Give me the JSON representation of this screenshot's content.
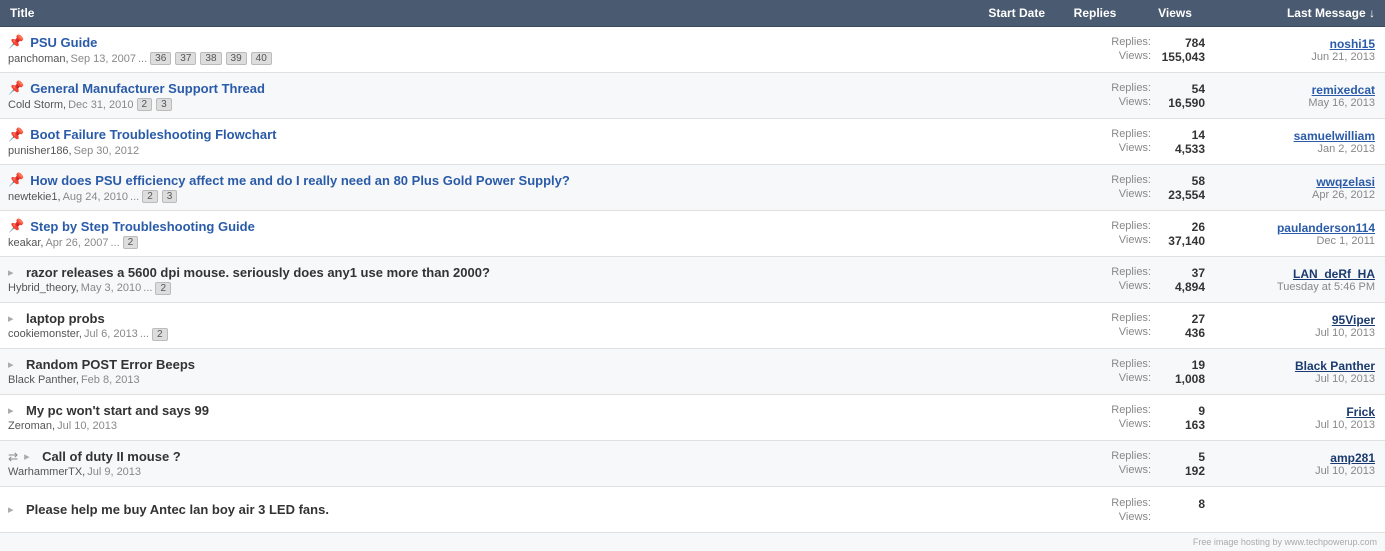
{
  "header": {
    "col_title": "Title",
    "col_start_date": "Start Date",
    "col_replies": "Replies",
    "col_views": "Views",
    "col_last_message": "Last Message ↓"
  },
  "rows": [
    {
      "id": "psu-guide",
      "pinned": true,
      "locked": false,
      "arrow": false,
      "multiicon": false,
      "title": "PSU Guide",
      "title_style": "link",
      "author": "panchoman",
      "date": "Sep 13, 2007",
      "has_ellipsis": true,
      "pages": [
        "36",
        "37",
        "38",
        "39",
        "40"
      ],
      "replies": "784",
      "views": "155,043",
      "last_user": "noshi15",
      "last_user_style": "normal",
      "last_date": "Jun 21, 2013"
    },
    {
      "id": "general-manufacturer",
      "pinned": true,
      "locked": false,
      "arrow": false,
      "multiicon": false,
      "title": "General Manufacturer Support Thread",
      "title_style": "link",
      "author": "Cold Storm",
      "date": "Dec 31, 2010",
      "has_ellipsis": false,
      "pages": [
        "2",
        "3"
      ],
      "replies": "54",
      "views": "16,590",
      "last_user": "remixedcat",
      "last_user_style": "normal",
      "last_date": "May 16, 2013"
    },
    {
      "id": "boot-failure",
      "pinned": true,
      "locked": false,
      "arrow": false,
      "multiicon": false,
      "title": "Boot Failure Troubleshooting Flowchart",
      "title_style": "link",
      "author": "punisher186",
      "date": "Sep 30, 2012",
      "has_ellipsis": false,
      "pages": [],
      "replies": "14",
      "views": "4,533",
      "last_user": "samuelwilliam",
      "last_user_style": "normal",
      "last_date": "Jan 2, 2013"
    },
    {
      "id": "psu-efficiency",
      "pinned": true,
      "locked": false,
      "arrow": false,
      "multiicon": false,
      "title": "How does PSU efficiency affect me and do I really need an 80 Plus Gold Power Supply?",
      "title_style": "link",
      "author": "newtekie1",
      "date": "Aug 24, 2010",
      "has_ellipsis": true,
      "pages": [
        "2",
        "3"
      ],
      "replies": "58",
      "views": "23,554",
      "last_user": "wwqzelasi",
      "last_user_style": "normal",
      "last_date": "Apr 26, 2012"
    },
    {
      "id": "step-by-step",
      "pinned": true,
      "locked": false,
      "arrow": false,
      "multiicon": false,
      "title": "Step by Step Troubleshooting Guide",
      "title_style": "link",
      "author": "keakar",
      "date": "Apr 26, 2007",
      "has_ellipsis": true,
      "pages": [
        "2"
      ],
      "replies": "26",
      "views": "37,140",
      "last_user": "paulanderson114",
      "last_user_style": "normal",
      "last_date": "Dec 1, 2011"
    },
    {
      "id": "razor-mouse",
      "pinned": false,
      "locked": false,
      "arrow": true,
      "multiicon": false,
      "title": "razor releases a 5600 dpi mouse. seriously does any1 use more than 2000?",
      "title_style": "dark-link",
      "author": "Hybrid_theory",
      "date": "May 3, 2010",
      "has_ellipsis": true,
      "pages": [
        "2"
      ],
      "replies": "37",
      "views": "4,894",
      "last_user": "LAN_deRf_HA",
      "last_user_style": "bold",
      "last_date": "Tuesday at 5:46 PM"
    },
    {
      "id": "laptop-probs",
      "pinned": false,
      "locked": false,
      "arrow": true,
      "multiicon": false,
      "title": "laptop probs",
      "title_style": "dark-link",
      "author": "cookiemonster",
      "date": "Jul 6, 2013",
      "has_ellipsis": true,
      "pages": [
        "2"
      ],
      "replies": "27",
      "views": "436",
      "last_user": "95Viper",
      "last_user_style": "bold",
      "last_date": "Jul 10, 2013"
    },
    {
      "id": "post-error-beeps",
      "pinned": false,
      "locked": false,
      "arrow": true,
      "multiicon": false,
      "title": "Random POST Error Beeps",
      "title_style": "dark-link",
      "author": "Black Panther",
      "date": "Feb 8, 2013",
      "has_ellipsis": false,
      "pages": [],
      "replies": "19",
      "views": "1,008",
      "last_user": "Black Panther",
      "last_user_style": "bold",
      "last_date": "Jul 10, 2013"
    },
    {
      "id": "pc-wont-start",
      "pinned": false,
      "locked": false,
      "arrow": true,
      "multiicon": false,
      "title": "My pc won't start and says 99",
      "title_style": "dark-link",
      "author": "Zeroman",
      "date": "Jul 10, 2013",
      "has_ellipsis": false,
      "pages": [],
      "replies": "9",
      "views": "163",
      "last_user": "Frick",
      "last_user_style": "bold",
      "last_date": "Jul 10, 2013"
    },
    {
      "id": "call-of-duty-mouse",
      "pinned": false,
      "locked": false,
      "arrow": true,
      "multiicon": true,
      "title": "Call of duty II mouse ?",
      "title_style": "dark-link",
      "author": "WarhammerTX",
      "date": "Jul 9, 2013",
      "has_ellipsis": false,
      "pages": [],
      "replies": "5",
      "views": "192",
      "last_user": "amp281",
      "last_user_style": "bold",
      "last_date": "Jul 10, 2013"
    },
    {
      "id": "antec-fan",
      "pinned": false,
      "locked": false,
      "arrow": true,
      "multiicon": false,
      "title": "Please help me buy Antec lan boy air 3 LED fans.",
      "title_style": "dark-link",
      "author": "",
      "date": "",
      "has_ellipsis": false,
      "pages": [],
      "replies": "8",
      "views": "",
      "last_user": "",
      "last_user_style": "normal",
      "last_date": ""
    }
  ],
  "watermark": "Free image hosting by www.techpowerup.com"
}
